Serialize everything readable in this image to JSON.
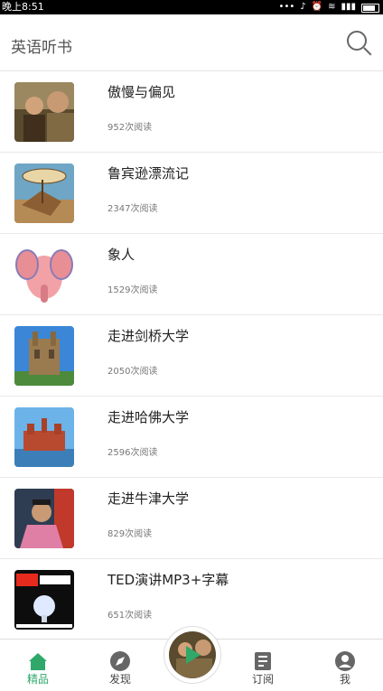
{
  "status_bar": {
    "time": "晚上8:51",
    "battery_icon": "battery-icon",
    "wifi_icon": "wifi-icon",
    "signal_icon": "signal-icon"
  },
  "header": {
    "title": "英语听书",
    "search_icon": "search-icon"
  },
  "books": [
    {
      "title": "傲慢与偏见",
      "reads": "952次阅读",
      "thumb": "portrait-scene"
    },
    {
      "title": "鲁宾逊漂流记",
      "reads": "2347次阅读",
      "thumb": "robinson-crusoe-cover"
    },
    {
      "title": "象人",
      "reads": "1529次阅读",
      "thumb": "elephant-cartoon"
    },
    {
      "title": "走进剑桥大学",
      "reads": "2050次阅读",
      "thumb": "cambridge-building"
    },
    {
      "title": "走进哈佛大学",
      "reads": "2596次阅读",
      "thumb": "harvard-building"
    },
    {
      "title": "走进牛津大学",
      "reads": "829次阅读",
      "thumb": "oxford-speaker"
    },
    {
      "title": "TED演讲MP3+字幕",
      "reads": "651次阅读",
      "thumb": "ted-talks-logo"
    }
  ],
  "tabbar": {
    "tabs": [
      {
        "label": "精品",
        "icon": "home-icon",
        "active": true
      },
      {
        "label": "发现",
        "icon": "compass-icon",
        "active": false
      },
      {
        "label": "订阅",
        "icon": "subscribe-icon",
        "active": false
      },
      {
        "label": "我",
        "icon": "user-icon",
        "active": false
      }
    ],
    "player_icon": "play-icon"
  },
  "colors": {
    "accent": "#2fa86a",
    "text": "#222222",
    "muted": "#777777"
  }
}
